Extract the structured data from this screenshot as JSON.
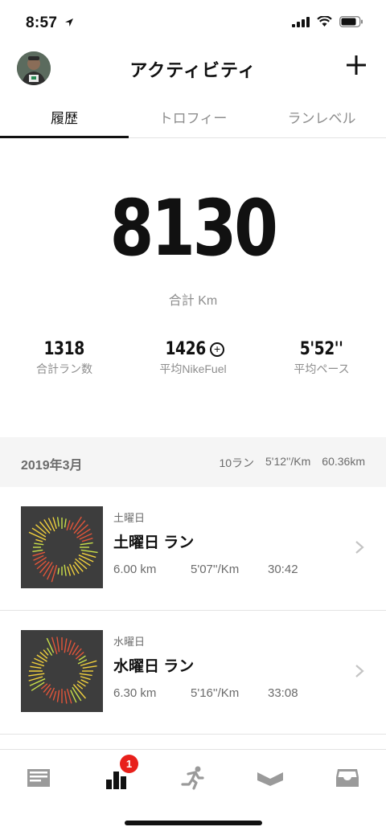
{
  "status": {
    "time": "8:57"
  },
  "header": {
    "title": "アクティビティ",
    "avatar_bib": "1"
  },
  "tabs": [
    {
      "label": "履歴",
      "active": true
    },
    {
      "label": "トロフィー",
      "active": false
    },
    {
      "label": "ランレベル",
      "active": false
    }
  ],
  "summary": {
    "total_value": "8130",
    "total_label": "合計 Km",
    "stats": [
      {
        "value": "1318",
        "label": "合計ラン数"
      },
      {
        "value": "1426",
        "label": "平均NikeFuel"
      },
      {
        "value": "5'52''",
        "label": "平均ペース"
      }
    ]
  },
  "month": {
    "title": "2019年3月",
    "runs": "10ラン",
    "pace": "5'12''/Km",
    "distance": "60.36km"
  },
  "runs": [
    {
      "day": "土曜日",
      "title": "土曜日 ラン",
      "distance": "6.00 km",
      "pace": "5'07''/Km",
      "duration": "30:42"
    },
    {
      "day": "水曜日",
      "title": "水曜日 ラン",
      "distance": "6.30 km",
      "pace": "5'16''/Km",
      "duration": "33:08"
    }
  ],
  "tabbar": {
    "items": [
      "feed-icon",
      "activity-icon",
      "run-icon",
      "club-icon",
      "inbox-icon"
    ],
    "badge": "1"
  },
  "colors": {
    "accent": "#111111",
    "badge": "#e8201b",
    "muted": "#8e8e8e",
    "section_bg": "#f5f5f5",
    "thumb_bg": "#3d3d3d"
  }
}
